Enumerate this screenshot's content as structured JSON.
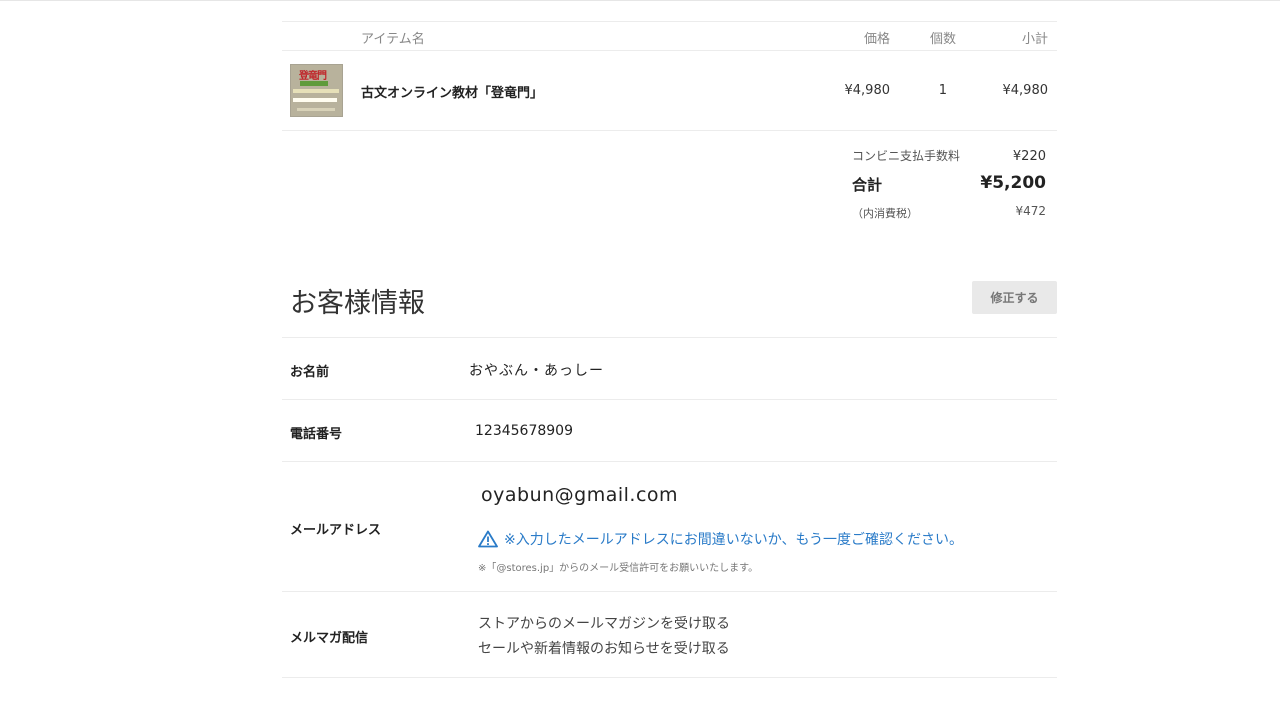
{
  "cart": {
    "headers": {
      "item_name": "アイテム名",
      "price": "価格",
      "quantity": "個数",
      "subtotal": "小計"
    },
    "items": [
      {
        "name": "古文オンライン教材「登竜門」",
        "price": "¥4,980",
        "quantity": "1",
        "subtotal": "¥4,980",
        "thumbnail_text": "登竜門"
      }
    ],
    "fee_label": "コンビニ支払手数料",
    "fee_value": "¥220",
    "total_label": "合計",
    "total_value": "¥5,200",
    "tax_label": "（内消費税）",
    "tax_value": "¥472"
  },
  "customer": {
    "title": "お客様情報",
    "edit_button": "修正する",
    "name_label": "お名前",
    "name_value": "おやぶん・あっしー",
    "phone_label": "電話番号",
    "phone_value": "12345678909",
    "email_label": "メールアドレス",
    "email_value": "oyabun@gmail.com",
    "email_warning": "※入力したメールアドレスにお間違いないか、もう一度ご確認ください。",
    "email_note": "※「@stores.jp」からのメール受信許可をお願いいたします。",
    "newsletter_label": "メルマガ配信",
    "newsletter_options": [
      "ストアからのメールマガジンを受け取る",
      "セールや新着情報のお知らせを受け取る"
    ]
  },
  "colors": {
    "warning": "#2a7bc8",
    "button_bg": "#e9e9e9"
  }
}
